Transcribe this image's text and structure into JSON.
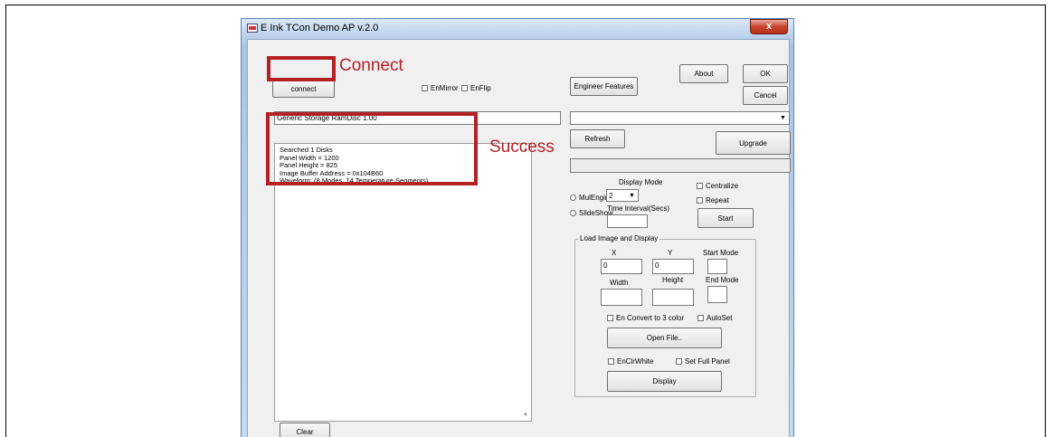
{
  "window": {
    "title": "E Ink TCon Demo AP v.2.0",
    "close_glyph": "x"
  },
  "toolbar": {
    "connect_label": "connect",
    "en_mirror_label": "EnMirror",
    "en_flip_label": "EnFlip",
    "engineer_features_label": "Engineer Features",
    "about_label": "About",
    "ok_label": "OK",
    "cancel_label": "Cancel"
  },
  "device_field": {
    "value": "Generic Storage RamDisc 1.00"
  },
  "device_select": {
    "value": ""
  },
  "refresh_label": "Refresh",
  "upgrade_label": "Upgrade",
  "log": {
    "lines": [
      "Searched 1 Disks",
      "Panel Width = 1200",
      "Panel Height = 825",
      "Image Buffer Address = 0x104B60",
      "Waveform: (8 Modes, 14 Temperature Segments)"
    ]
  },
  "clear_label": "Clear",
  "display_mode": {
    "label": "Display Mode",
    "value": "2",
    "mul_engine_label": "MulEngine",
    "slide_show_label": "SlideShow",
    "time_interval_label": "Time Interval(Secs)",
    "time_interval_value": "",
    "centralize_label": "Centralize",
    "repeat_label": "Repeat",
    "start_label": "Start"
  },
  "load_image": {
    "group_label": "Load Image and Display",
    "x_label": "X",
    "y_label": "Y",
    "start_mode_label": "Start Mode",
    "x_value": "0",
    "y_value": "0",
    "start_mode_value": "",
    "width_label": "Width",
    "height_label": "Height",
    "end_mode_label": "End Mode",
    "width_value": "",
    "height_value": "",
    "end_mode_value": "",
    "en_convert_label": "En Convert to 3 color",
    "auto_set_label": "AutoSet",
    "open_file_label": "Open File..",
    "en_clr_white_label": "EnClrWhite",
    "set_full_panel_label": "Set Full Panel",
    "display_label": "Display"
  },
  "annotations": {
    "connect": "Connect",
    "success": "Success",
    "color": "#b52025"
  }
}
